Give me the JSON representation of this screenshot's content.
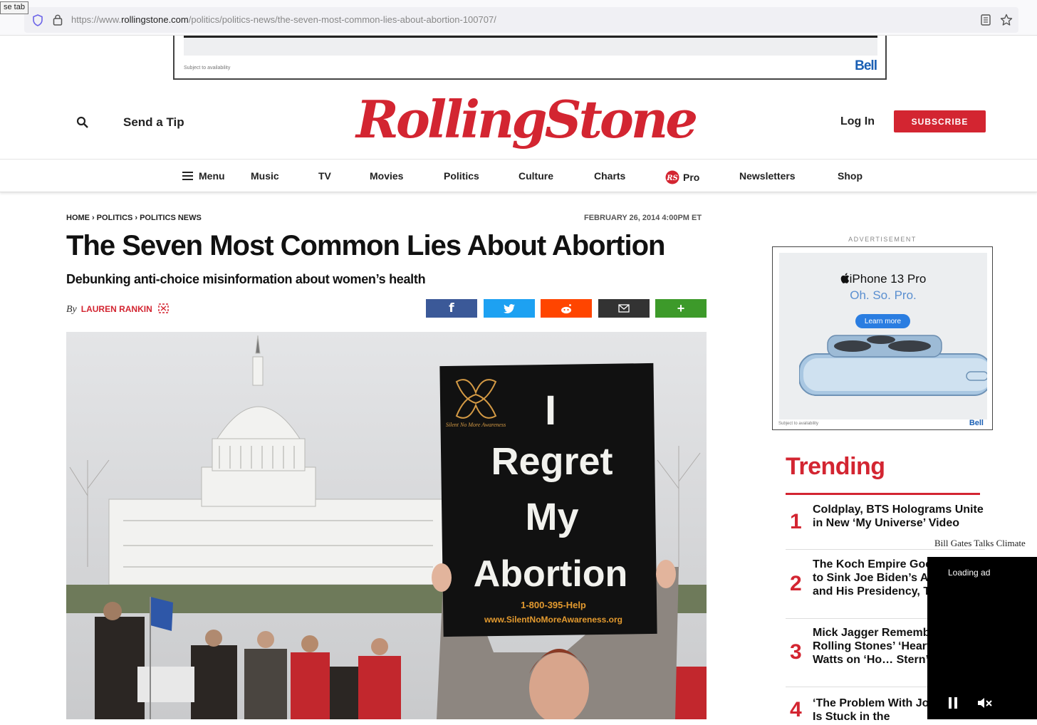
{
  "browser": {
    "tooltip": "se tab",
    "url_prefix": "https://www.",
    "url_domain": "rollingstone.com",
    "url_path": "/politics/politics-news/the-seven-most-common-lies-about-abortion-100707/"
  },
  "top_ad": {
    "fine_print": "Subject to availability",
    "brand": "Bell"
  },
  "header": {
    "send_tip": "Send a Tip",
    "logo": "RollingStone",
    "login": "Log In",
    "subscribe": "SUBSCRIBE"
  },
  "nav": {
    "menu": "Menu",
    "items": [
      "Music",
      "TV",
      "Movies",
      "Politics",
      "Culture",
      "Charts",
      "Pro",
      "Newsletters",
      "Shop"
    ]
  },
  "article": {
    "breadcrumb": [
      "HOME",
      "POLITICS",
      "POLITICS NEWS"
    ],
    "date": "FEBRUARY 26, 2014 4:00PM ET",
    "headline": "The Seven Most Common Lies About Abortion",
    "subhead": "Debunking anti-choice misinformation about women’s health",
    "by": "By",
    "author": "LAUREN RANKIN",
    "share": {
      "facebook": "f",
      "more": "+"
    },
    "sign": {
      "line1": "I",
      "line2": "Regret",
      "line3": "My",
      "line4": "Abortion",
      "phone": "1-800-395-Help",
      "site": "www.SilentNoMoreAwareness.org",
      "org": "Silent No More Awareness"
    }
  },
  "side_ad": {
    "label": "ADVERTISEMENT",
    "title": "iPhone 13 Pro",
    "tagline": "Oh. So. Pro.",
    "button": "Learn more",
    "fine_print": "Subject to availability",
    "brand": "Bell"
  },
  "trending": {
    "title": "Trending",
    "items": [
      {
        "num": "1",
        "text": "Coldplay, BTS Holograms Unite in New ‘My Universe’ Video"
      },
      {
        "num": "2",
        "text": "The Koch Empire Goes All Out to Sink Joe Biden’s Agenda — and His Presidency, Too"
      },
      {
        "num": "3",
        "text": "Mick Jagger Remembers Rolling Stones’ ‘Heart’ Charlie Watts on ‘Ho… Stern’"
      },
      {
        "num": "4",
        "text": "‘The Problem With Jon Stewart’ Is Stuck in the"
      }
    ]
  },
  "video": {
    "caption": "Bill Gates Talks Climate",
    "status": "Loading ad"
  },
  "colors": {
    "brand_red": "#d32531",
    "facebook": "#3b5998",
    "twitter": "#1da1f2",
    "reddit": "#ff4500",
    "email": "#333333",
    "more": "#3d9a2a"
  }
}
